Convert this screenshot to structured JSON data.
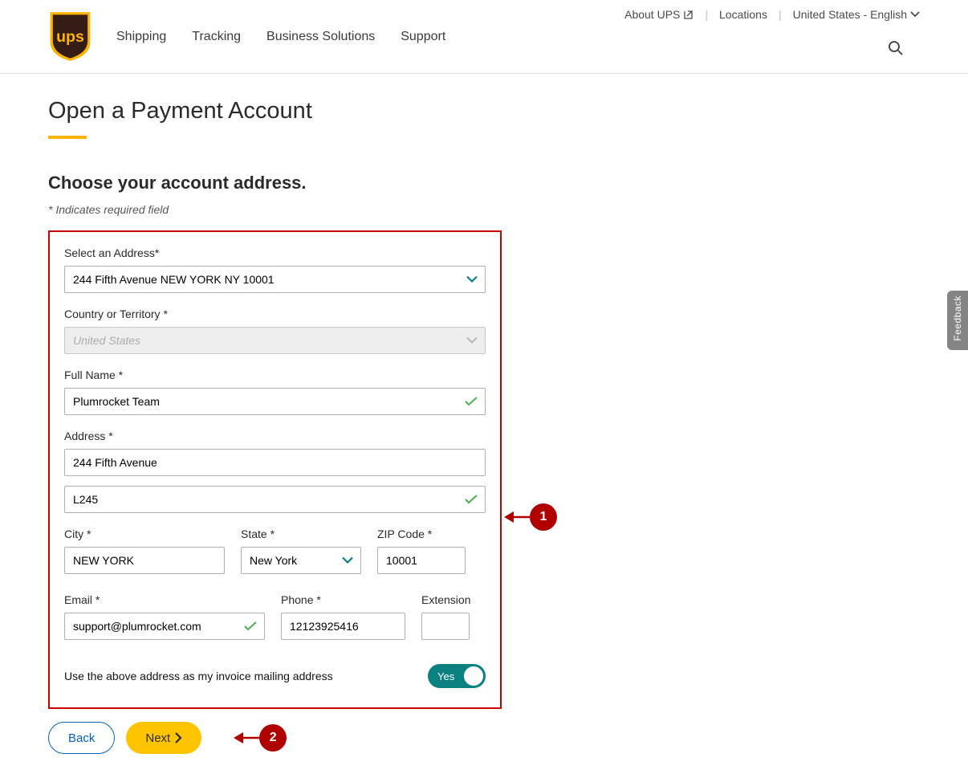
{
  "top_nav": {
    "about": "About UPS",
    "locations": "Locations",
    "locale": "United States - English"
  },
  "main_nav": {
    "shipping": "Shipping",
    "tracking": "Tracking",
    "business": "Business Solutions",
    "support": "Support"
  },
  "page": {
    "title": "Open a Payment Account",
    "subtitle": "Choose your account address.",
    "required_note": "* Indicates required field"
  },
  "form": {
    "select_address": {
      "label": "Select an Address*",
      "value": "244 Fifth Avenue NEW YORK NY 10001"
    },
    "country": {
      "label": "Country or Territory *",
      "value": "United States"
    },
    "full_name": {
      "label": "Full Name *",
      "value": "Plumrocket Team"
    },
    "address": {
      "label": "Address *",
      "line1": "244 Fifth Avenue",
      "line2": "L245"
    },
    "city": {
      "label": "City *",
      "value": "NEW YORK"
    },
    "state": {
      "label": "State *",
      "value": "New York"
    },
    "zip": {
      "label": "ZIP Code *",
      "value": "10001"
    },
    "email": {
      "label": "Email *",
      "value": "support@plumrocket.com"
    },
    "phone": {
      "label": "Phone *",
      "value": "12123925416"
    },
    "extension": {
      "label": "Extension",
      "value": ""
    },
    "invoice_toggle": {
      "label": "Use the above address as my invoice mailing address",
      "state": "Yes"
    }
  },
  "buttons": {
    "back": "Back",
    "next": "Next"
  },
  "callouts": {
    "one": "1",
    "two": "2"
  },
  "feedback": "Feedback"
}
